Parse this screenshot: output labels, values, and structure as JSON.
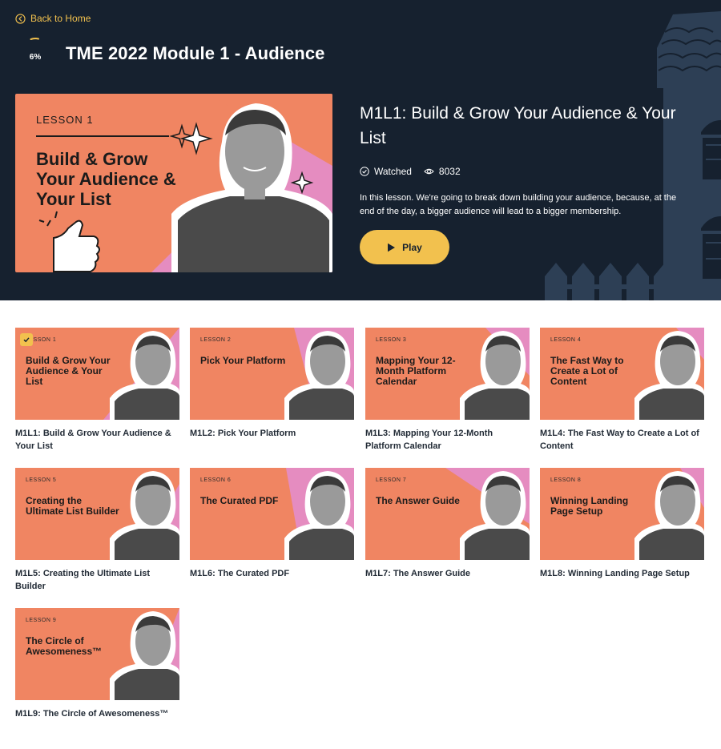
{
  "nav": {
    "back_label": "Back to Home"
  },
  "module": {
    "progress_label": "6%",
    "progress_fraction": 0.06,
    "title": "TME 2022 Module 1 - Audience"
  },
  "current_lesson": {
    "thumb_lesson_no": "LESSON 1",
    "thumb_title": "Build & Grow Your Audience & Your List",
    "title": "M1L1: Build & Grow Your Audience & Your List",
    "watched_label": "Watched",
    "views": "8032",
    "description": "In this lesson. We're going to break down building your audience, because, at the end of the day, a bigger audience will lead to a bigger membership.",
    "play_label": "Play"
  },
  "lessons": [
    {
      "thumb_no": "LESSON 1",
      "thumb_title": "Build & Grow Your Audience & Your List",
      "caption": "M1L1: Build & Grow Your Audience & Your List",
      "watched": true
    },
    {
      "thumb_no": "LESSON 2",
      "thumb_title": "Pick Your Platform",
      "caption": "M1L2: Pick Your Platform",
      "watched": false
    },
    {
      "thumb_no": "LESSON 3",
      "thumb_title": "Mapping Your 12-Month Platform Calendar",
      "caption": "M1L3: Mapping Your 12-Month Platform Calendar",
      "watched": false
    },
    {
      "thumb_no": "LESSON 4",
      "thumb_title": "The Fast Way to Create a Lot of Content",
      "caption": "M1L4: The Fast Way to Create a Lot of Content",
      "watched": false
    },
    {
      "thumb_no": "LESSON 5",
      "thumb_title": "Creating the Ultimate List Builder",
      "caption": "M1L5: Creating the Ultimate List Builder",
      "watched": false
    },
    {
      "thumb_no": "LESSON 6",
      "thumb_title": "The Curated PDF",
      "caption": "M1L6: The Curated PDF",
      "watched": false
    },
    {
      "thumb_no": "LESSON 7",
      "thumb_title": "The Answer Guide",
      "caption": "M1L7: The Answer Guide",
      "watched": false
    },
    {
      "thumb_no": "LESSON 8",
      "thumb_title": "Winning Landing Page Setup",
      "caption": "M1L8: Winning Landing Page Setup",
      "watched": false
    },
    {
      "thumb_no": "LESSON 9",
      "thumb_title": "The Circle of Awesomeness™",
      "caption": "M1L9: The Circle of Awesomeness™",
      "watched": false
    }
  ],
  "colors": {
    "hero_bg": "#16212f",
    "accent": "#f2c14e",
    "thumb_orange": "#f08562",
    "thumb_pink": "#e58cc0"
  },
  "icons": {
    "back": "chevron-left-circle-icon",
    "watched": "check-circle-icon",
    "views": "eye-icon",
    "play": "play-icon"
  }
}
